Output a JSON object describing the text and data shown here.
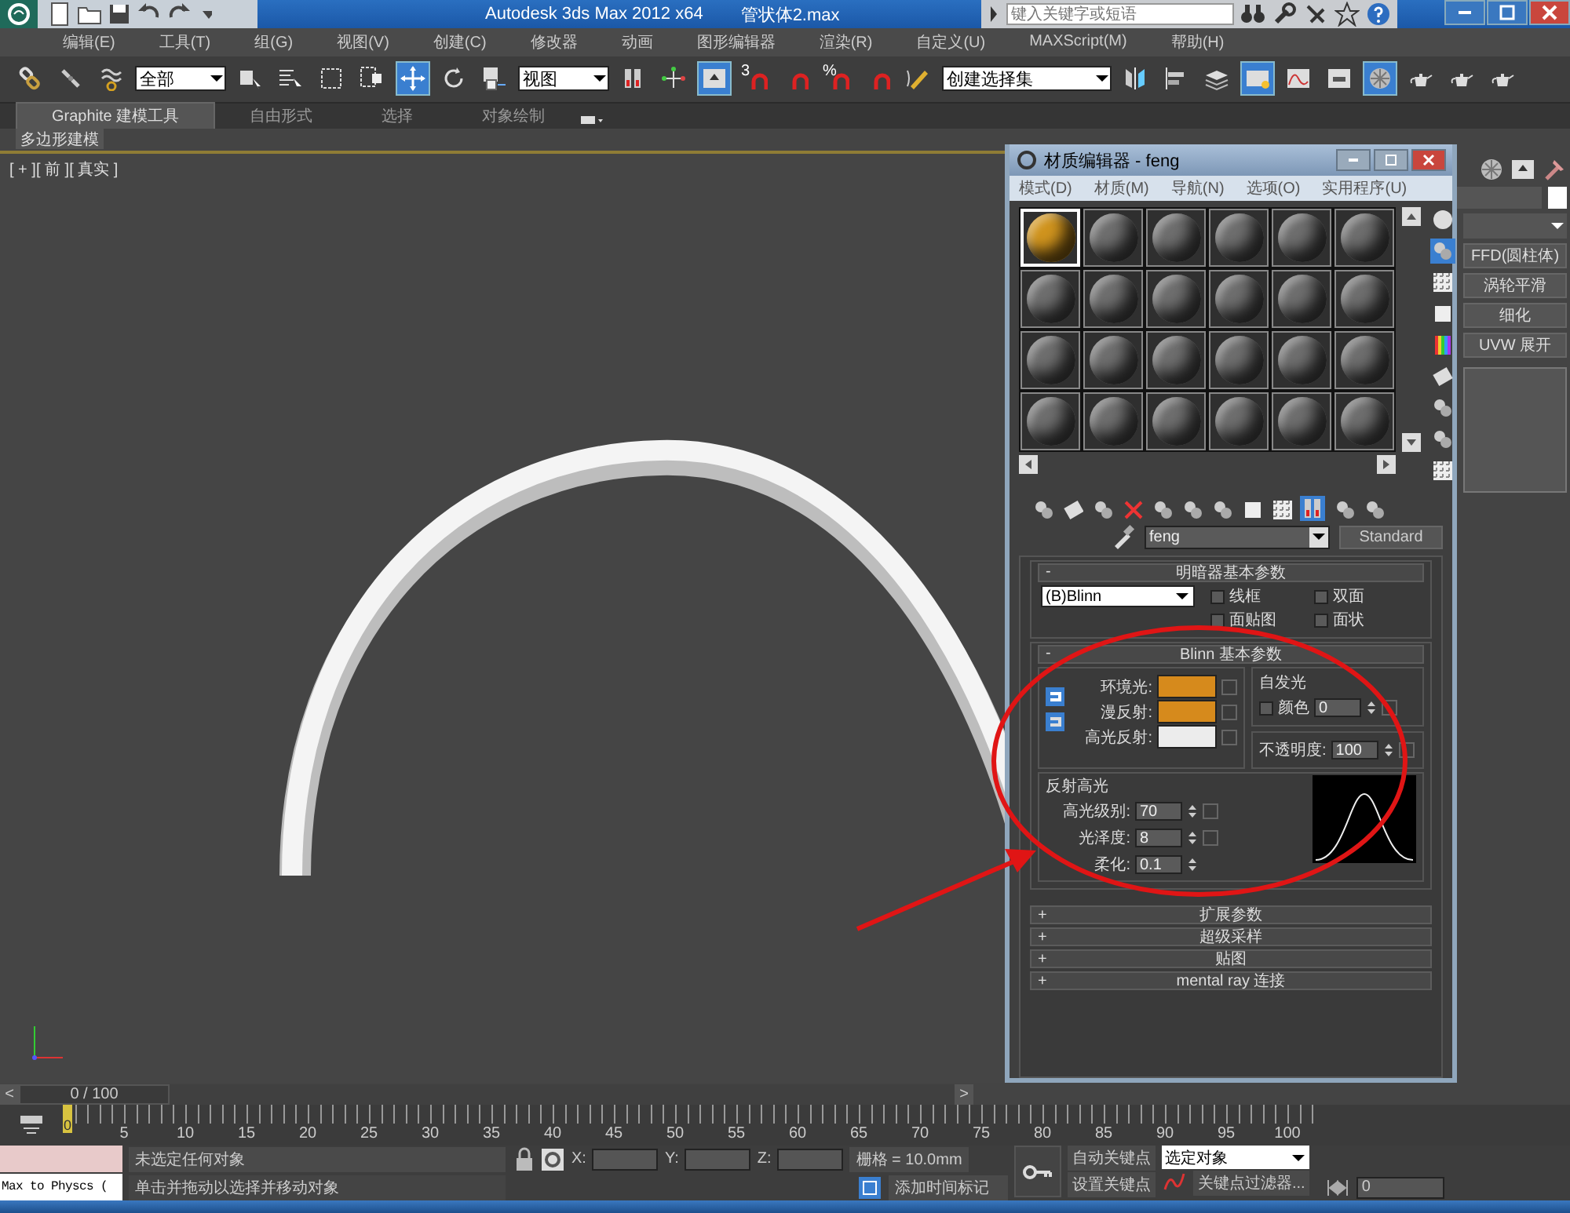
{
  "title_bar": {
    "title": "Autodesk 3ds Max  2012 x64",
    "file_name": "管状体2.max",
    "search": {
      "placeholder": "键入关键字或短语"
    }
  },
  "menu_bar": [
    "编辑(E)",
    "工具(T)",
    "组(G)",
    "视图(V)",
    "创建(C)",
    "修改器",
    "动画",
    "图形编辑器",
    "渲染(R)",
    "自定义(U)",
    "MAXScript(M)",
    "帮助(H)"
  ],
  "main_toolbar": [
    {
      "kind": "button",
      "active": false
    },
    {
      "kind": "button",
      "active": false
    },
    {
      "kind": "button",
      "active": false
    },
    {
      "kind": "dropdown",
      "value": "全部"
    },
    {
      "kind": "button",
      "active": false
    },
    {
      "kind": "button",
      "active": false
    },
    {
      "kind": "button",
      "active": false
    },
    {
      "kind": "button",
      "active": false
    },
    {
      "kind": "button",
      "active": true
    },
    {
      "kind": "button",
      "active": false
    },
    {
      "kind": "button",
      "active": false
    },
    {
      "kind": "dropdown",
      "value": "视图"
    },
    {
      "kind": "button",
      "active": false
    },
    {
      "kind": "button",
      "active": false
    },
    {
      "kind": "button",
      "active": true
    },
    {
      "kind": "button",
      "active": false,
      "glyph": "3"
    },
    {
      "kind": "button",
      "active": false
    },
    {
      "kind": "button",
      "active": false,
      "glyph": "%"
    },
    {
      "kind": "button",
      "active": false
    },
    {
      "kind": "button",
      "active": false
    },
    {
      "kind": "dropdown",
      "value": "创建选择集"
    },
    {
      "kind": "button",
      "active": false
    },
    {
      "kind": "button",
      "active": false
    },
    {
      "kind": "button",
      "active": false
    },
    {
      "kind": "button",
      "active": true
    },
    {
      "kind": "button",
      "active": false
    },
    {
      "kind": "button",
      "active": false
    },
    {
      "kind": "button",
      "active": true
    },
    {
      "kind": "button",
      "active": false
    },
    {
      "kind": "button",
      "active": false
    },
    {
      "kind": "button",
      "active": false
    }
  ],
  "ribbon": {
    "tabs": [
      {
        "label": "Graphite 建模工具",
        "selected": true
      },
      {
        "label": "自由形式",
        "selected": false
      },
      {
        "label": "选择",
        "selected": false
      },
      {
        "label": "对象绘制",
        "selected": false
      }
    ],
    "panel": "多边形建模"
  },
  "viewport": {
    "label": "[ + ][ 前 ][ 真实 ]"
  },
  "command_panel": {
    "modifier_buttons": [
      "FFD(圆柱体)",
      "涡轮平滑",
      "细化",
      "UVW 展开"
    ]
  },
  "material_editor": {
    "title": "材质编辑器 - feng",
    "menu": [
      "模式(D)",
      "材质(M)",
      "导航(N)",
      "选项(O)",
      "实用程序(U)"
    ],
    "slots": [
      {
        "selected": true,
        "color": "#d0941e"
      },
      {
        "selected": false,
        "color": "#6e6e6e"
      },
      {
        "selected": false,
        "color": "#6e6e6e"
      },
      {
        "selected": false,
        "color": "#6e6e6e"
      },
      {
        "selected": false,
        "color": "#6e6e6e"
      },
      {
        "selected": false,
        "color": "#6e6e6e"
      },
      {
        "selected": false,
        "color": "#6e6e6e"
      },
      {
        "selected": false,
        "color": "#6e6e6e"
      },
      {
        "selected": false,
        "color": "#6e6e6e"
      },
      {
        "selected": false,
        "color": "#6e6e6e"
      },
      {
        "selected": false,
        "color": "#6e6e6e"
      },
      {
        "selected": false,
        "color": "#6e6e6e"
      },
      {
        "selected": false,
        "color": "#6e6e6e"
      },
      {
        "selected": false,
        "color": "#6e6e6e"
      },
      {
        "selected": false,
        "color": "#6e6e6e"
      },
      {
        "selected": false,
        "color": "#6e6e6e"
      },
      {
        "selected": false,
        "color": "#6e6e6e"
      },
      {
        "selected": false,
        "color": "#6e6e6e"
      },
      {
        "selected": false,
        "color": "#6e6e6e"
      },
      {
        "selected": false,
        "color": "#6e6e6e"
      },
      {
        "selected": false,
        "color": "#6e6e6e"
      },
      {
        "selected": false,
        "color": "#6e6e6e"
      },
      {
        "selected": false,
        "color": "#6e6e6e"
      },
      {
        "selected": false,
        "color": "#6e6e6e"
      }
    ],
    "material_name": "feng",
    "material_type": "Standard",
    "shader_rollout": {
      "sign": "-",
      "title": "明暗器基本参数",
      "shader": "(B)Blinn",
      "options": [
        {
          "label": "线框",
          "checked": false
        },
        {
          "label": "双面",
          "checked": false
        },
        {
          "label": "面贴图",
          "checked": false
        },
        {
          "label": "面状",
          "checked": false
        }
      ]
    },
    "blinn_rollout": {
      "sign": "-",
      "title": "Blinn 基本参数",
      "colors": [
        {
          "label": "环境光:",
          "color": "#d68a1c"
        },
        {
          "label": "漫反射:",
          "color": "#d68a1c"
        },
        {
          "label": "高光反射:",
          "color": "#ececec"
        }
      ],
      "self_illumination": {
        "title": "自发光",
        "label": "颜色",
        "checked": false,
        "value": "0"
      },
      "opacity": {
        "label": "不透明度:",
        "value": "100"
      },
      "specular": {
        "title": "反射高光",
        "fields": [
          {
            "label": "高光级别:",
            "value": "70"
          },
          {
            "label": "光泽度:",
            "value": "8"
          },
          {
            "label": "柔化:",
            "value": "0.1"
          }
        ]
      }
    },
    "collapsed_rollouts": [
      {
        "sign": "+",
        "title": "扩展参数"
      },
      {
        "sign": "+",
        "title": "超级采样"
      },
      {
        "sign": "+",
        "title": "贴图"
      },
      {
        "sign": "+",
        "title": "mental ray 连接"
      }
    ]
  },
  "annotations": {
    "ellipse_mark": true,
    "arrow_mark": true
  },
  "time_slider": {
    "prev": "<",
    "position": "0 / 100",
    "next": ">"
  },
  "time_ruler": {
    "current": "0",
    "level": 0,
    "labels": [
      "5",
      "10",
      "15",
      "20",
      "25",
      "30",
      "35",
      "40",
      "45",
      "50",
      "55",
      "60",
      "65",
      "70",
      "75",
      "80",
      "85",
      "90",
      "95",
      "100"
    ]
  },
  "status_bar": {
    "listener_output": "Max to Physcs (",
    "selection_info": "未选定任何对象",
    "prompt": "单击并拖动以选择并移动对象",
    "coords": [
      "X:",
      "Y:",
      "Z:"
    ],
    "grid": "栅格 = 10.0mm",
    "add_time_tag": "添加时间标记",
    "auto_key": "自动关键点",
    "key_mode": "选定对象",
    "set_key": "设置关键点",
    "key_filters": "关键点过滤器...",
    "frame": "0"
  }
}
